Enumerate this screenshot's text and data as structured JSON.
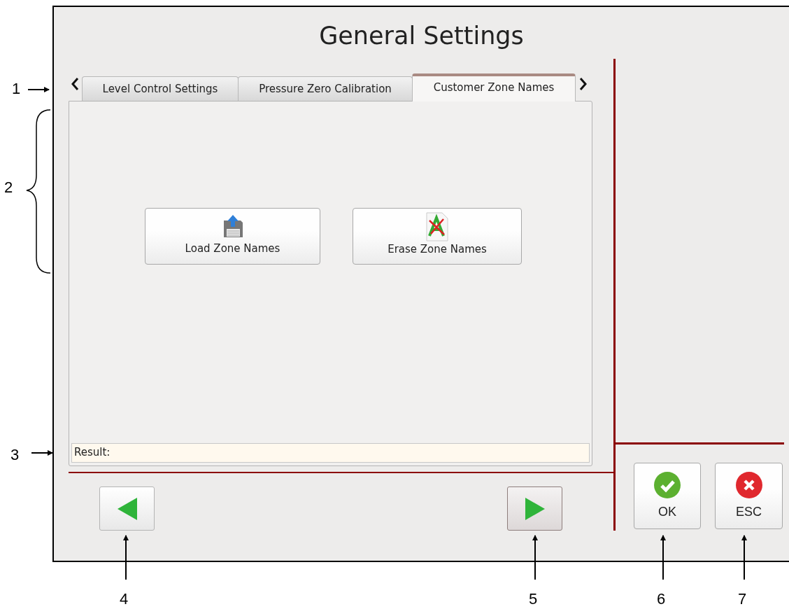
{
  "window": {
    "title": "General Settings"
  },
  "tabs": [
    {
      "label": "Level Control Settings",
      "selected": false
    },
    {
      "label": "Pressure Zero Calibration",
      "selected": false
    },
    {
      "label": "Customer Zone Names",
      "selected": true
    }
  ],
  "actions": [
    {
      "label": "Load Zone Names",
      "kind": "load"
    },
    {
      "label": "Erase Zone Names",
      "kind": "erase"
    }
  ],
  "result": {
    "label": "Result:"
  },
  "dialog_buttons": [
    {
      "label": "OK",
      "kind": "ok"
    },
    {
      "label": "ESC",
      "kind": "cancel"
    }
  ],
  "callouts": [
    "1",
    "2",
    "3",
    "4",
    "5",
    "6",
    "7"
  ]
}
